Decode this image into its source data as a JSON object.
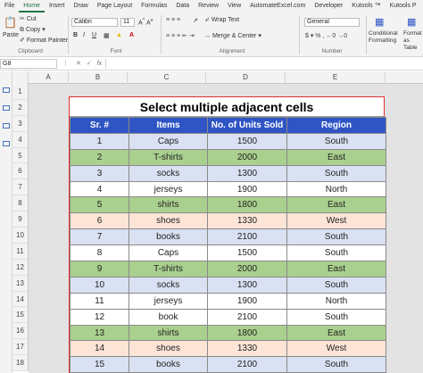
{
  "menu": {
    "tabs": [
      "File",
      "Home",
      "Insert",
      "Draw",
      "Page Layout",
      "Formulas",
      "Data",
      "Review",
      "View",
      "AutomateExcel.com",
      "Developer",
      "Kutools ™",
      "Kutools P"
    ],
    "active": "Home"
  },
  "ribbon": {
    "paste": "Paste",
    "cut": "Cut",
    "copy": "Copy",
    "format_painter": "Format Painter",
    "font_name": "Calibri",
    "font_size": "11",
    "wrap_text": "Wrap Text",
    "merge_center": "Merge & Center",
    "number_format": "General",
    "conditional_formatting": "Conditional Formatting",
    "format_as_table": "Format as Table",
    "groups": {
      "clipboard": "Clipboard",
      "font": "Font",
      "alignment": "Alignment",
      "number": "Number"
    },
    "colors": {
      "accent": "#217346"
    }
  },
  "formula_bar": {
    "name_box": "G8",
    "fx": "fx",
    "value": ""
  },
  "grid": {
    "columns": [
      "A",
      "B",
      "C",
      "D",
      "E"
    ],
    "rows": [
      "1",
      "2",
      "3",
      "4",
      "5",
      "6",
      "7",
      "8",
      "9",
      "10",
      "11",
      "12",
      "13",
      "14",
      "15",
      "16",
      "17",
      "18"
    ]
  },
  "table": {
    "title": "Select multiple adjacent cells",
    "headers": [
      "Sr. #",
      "Items",
      "No. of Units Sold",
      "Region"
    ],
    "rows": [
      {
        "sr": "1",
        "item": "Caps",
        "units": "1500",
        "region": "South",
        "fill": "blue"
      },
      {
        "sr": "2",
        "item": "T-shirts",
        "units": "2000",
        "region": "East",
        "fill": "green"
      },
      {
        "sr": "3",
        "item": "socks",
        "units": "1300",
        "region": "South",
        "fill": "blue"
      },
      {
        "sr": "4",
        "item": "jerseys",
        "units": "1900",
        "region": "North",
        "fill": "white"
      },
      {
        "sr": "5",
        "item": "shirts",
        "units": "1800",
        "region": "East",
        "fill": "green"
      },
      {
        "sr": "6",
        "item": "shoes",
        "units": "1330",
        "region": "West",
        "fill": "peach"
      },
      {
        "sr": "7",
        "item": "books",
        "units": "2100",
        "region": "South",
        "fill": "blue"
      },
      {
        "sr": "8",
        "item": "Caps",
        "units": "1500",
        "region": "South",
        "fill": "white"
      },
      {
        "sr": "9",
        "item": "T-shirts",
        "units": "2000",
        "region": "East",
        "fill": "green"
      },
      {
        "sr": "10",
        "item": "socks",
        "units": "1300",
        "region": "South",
        "fill": "blue"
      },
      {
        "sr": "11",
        "item": "jerseys",
        "units": "1900",
        "region": "North",
        "fill": "white"
      },
      {
        "sr": "12",
        "item": "book",
        "units": "2100",
        "region": "South",
        "fill": "white"
      },
      {
        "sr": "13",
        "item": "shirts",
        "units": "1800",
        "region": "East",
        "fill": "green"
      },
      {
        "sr": "14",
        "item": "shoes",
        "units": "1330",
        "region": "West",
        "fill": "peach"
      },
      {
        "sr": "15",
        "item": "books",
        "units": "2100",
        "region": "South",
        "fill": "blue"
      }
    ],
    "colors": {
      "header": "#2f55c4",
      "blue": "#d9e1f2",
      "green": "#a9d08e",
      "peach": "#fce4d6",
      "white": "#ffffff",
      "selection_border": "#e03030"
    }
  }
}
